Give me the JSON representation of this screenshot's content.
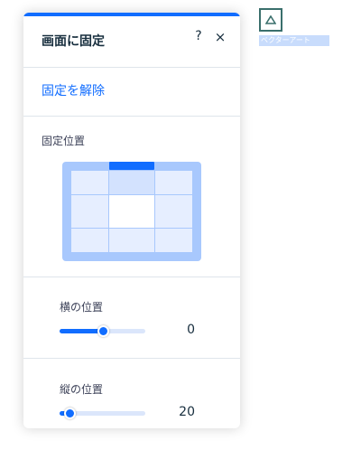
{
  "panel": {
    "title": "画面に固定",
    "help_label": "?",
    "close_label": "×",
    "unpin_label": "固定を解除",
    "position_label": "固定位置",
    "selected_position": "top-center",
    "horizontal": {
      "label": "横の位置",
      "value": "0",
      "fraction": 0.5
    },
    "vertical": {
      "label": "縦の位置",
      "value": "20",
      "fraction": 0.12
    },
    "accent_color": "#116dff"
  },
  "canvas": {
    "element_label": "ベクターアート",
    "element_icon": "triangle-icon"
  }
}
